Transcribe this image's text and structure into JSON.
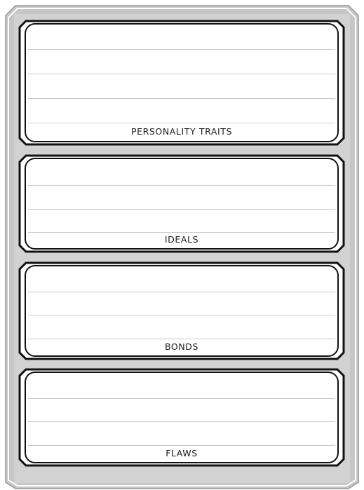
{
  "sheet": {
    "sections": [
      {
        "label": "PERSONALITY TRAITS",
        "lines": 5
      },
      {
        "label": "IDEALS",
        "lines": 3
      },
      {
        "label": "BONDS",
        "lines": 3
      },
      {
        "label": "FLAWS",
        "lines": 3
      }
    ]
  },
  "colors": {
    "outer_frame": "#c6c6c6",
    "outer_frame_edge": "#8c8c8c",
    "box_border": "#111111",
    "rule_lines": "#c9c9c9",
    "box_fill": "#ffffff"
  }
}
